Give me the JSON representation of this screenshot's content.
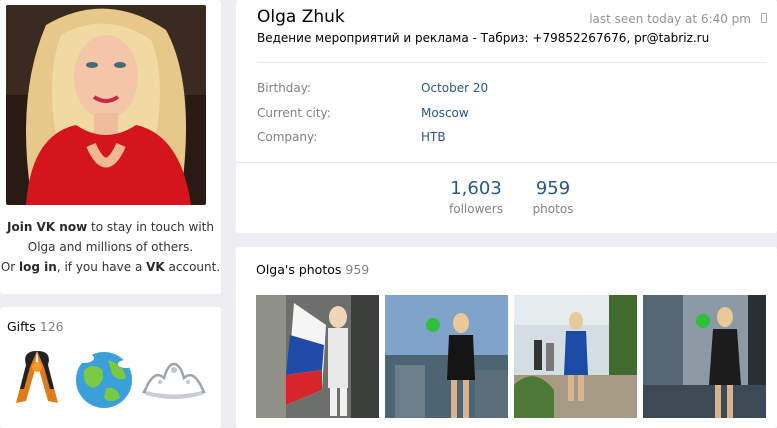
{
  "left": {
    "join_strong": "Join VK now",
    "join_rest": " to stay in touch with",
    "join_line2": "Olga and millions of others.",
    "join_or": "Or ",
    "join_login": "log in",
    "join_mid": ", if you have a ",
    "join_vk": "VK",
    "join_end": " account."
  },
  "gifts": {
    "title": "Gifts",
    "count": "126",
    "items": [
      "ribbon-icon",
      "globe-icon",
      "tiara-icon"
    ]
  },
  "profile": {
    "name": "Olga Zhuk",
    "last_seen": "last seen today at 6:40 pm",
    "status": "Ведение мероприятий и реклама - Табриз: +79852267676, pr@tabriz.ru",
    "info": [
      {
        "label": "Birthday:",
        "value": "October 20"
      },
      {
        "label": "Current city:",
        "value": "Moscow"
      },
      {
        "label": "Company:",
        "value": "НТВ"
      }
    ],
    "counters": [
      {
        "num": "1,603",
        "label": "followers"
      },
      {
        "num": "959",
        "label": "photos"
      }
    ]
  },
  "photos": {
    "title": "Olga's photos",
    "count": "959"
  },
  "colors": {
    "link": "#2a5885",
    "muted": "#828282",
    "background": "#edeef0"
  }
}
